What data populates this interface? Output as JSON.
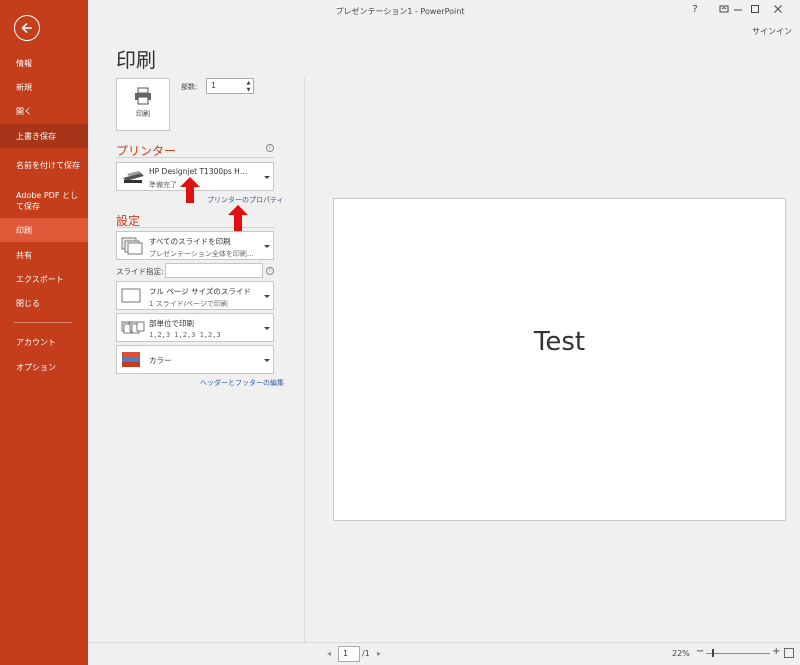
{
  "titlebar": {
    "title": "プレゼンテーション1 - PowerPoint",
    "help": "?",
    "signin": "サインイン"
  },
  "sidebar": {
    "items": [
      {
        "label": "情報"
      },
      {
        "label": "新規"
      },
      {
        "label": "開く"
      },
      {
        "label": "上書き保存"
      },
      {
        "label": "名前を付けて保存"
      },
      {
        "label": "Adobe PDF として保存"
      },
      {
        "label": "印刷"
      },
      {
        "label": "共有"
      },
      {
        "label": "エクスポート"
      },
      {
        "label": "閉じる"
      },
      {
        "label": "アカウント"
      },
      {
        "label": "オプション"
      }
    ]
  },
  "print": {
    "title": "印刷",
    "button_label": "印刷",
    "copies_label": "部数:",
    "copies_value": "1"
  },
  "printer": {
    "header": "プリンター",
    "name": "HP Designjet T1300ps H…",
    "status": "準備完了",
    "properties_link": "プリンターのプロパティ"
  },
  "settings": {
    "header": "設定",
    "range": {
      "line1": "すべてのスライドを印刷",
      "line2": "プレゼンテーション全体を印刷…"
    },
    "slides_label": "スライド指定:",
    "slides_value": "",
    "layout": {
      "line1": "フル ページ サイズのスライド",
      "line2": "1 スライド/ページで印刷"
    },
    "collate": {
      "line1": "部単位で印刷",
      "line2": "1,2,3   1,2,3   1,2,3"
    },
    "color": {
      "line1": "カラー"
    },
    "header_footer_link": "ヘッダーとフッターの編集"
  },
  "preview": {
    "slide_text": "Test",
    "page_current": "1",
    "page_total": "/1",
    "zoom": "22%"
  },
  "colors": {
    "accent": "#c43e1c",
    "sidebar_selected": "#e05a3a",
    "sidebar_active": "#a8351a",
    "link": "#2b579a",
    "annotation": "#e01010"
  }
}
